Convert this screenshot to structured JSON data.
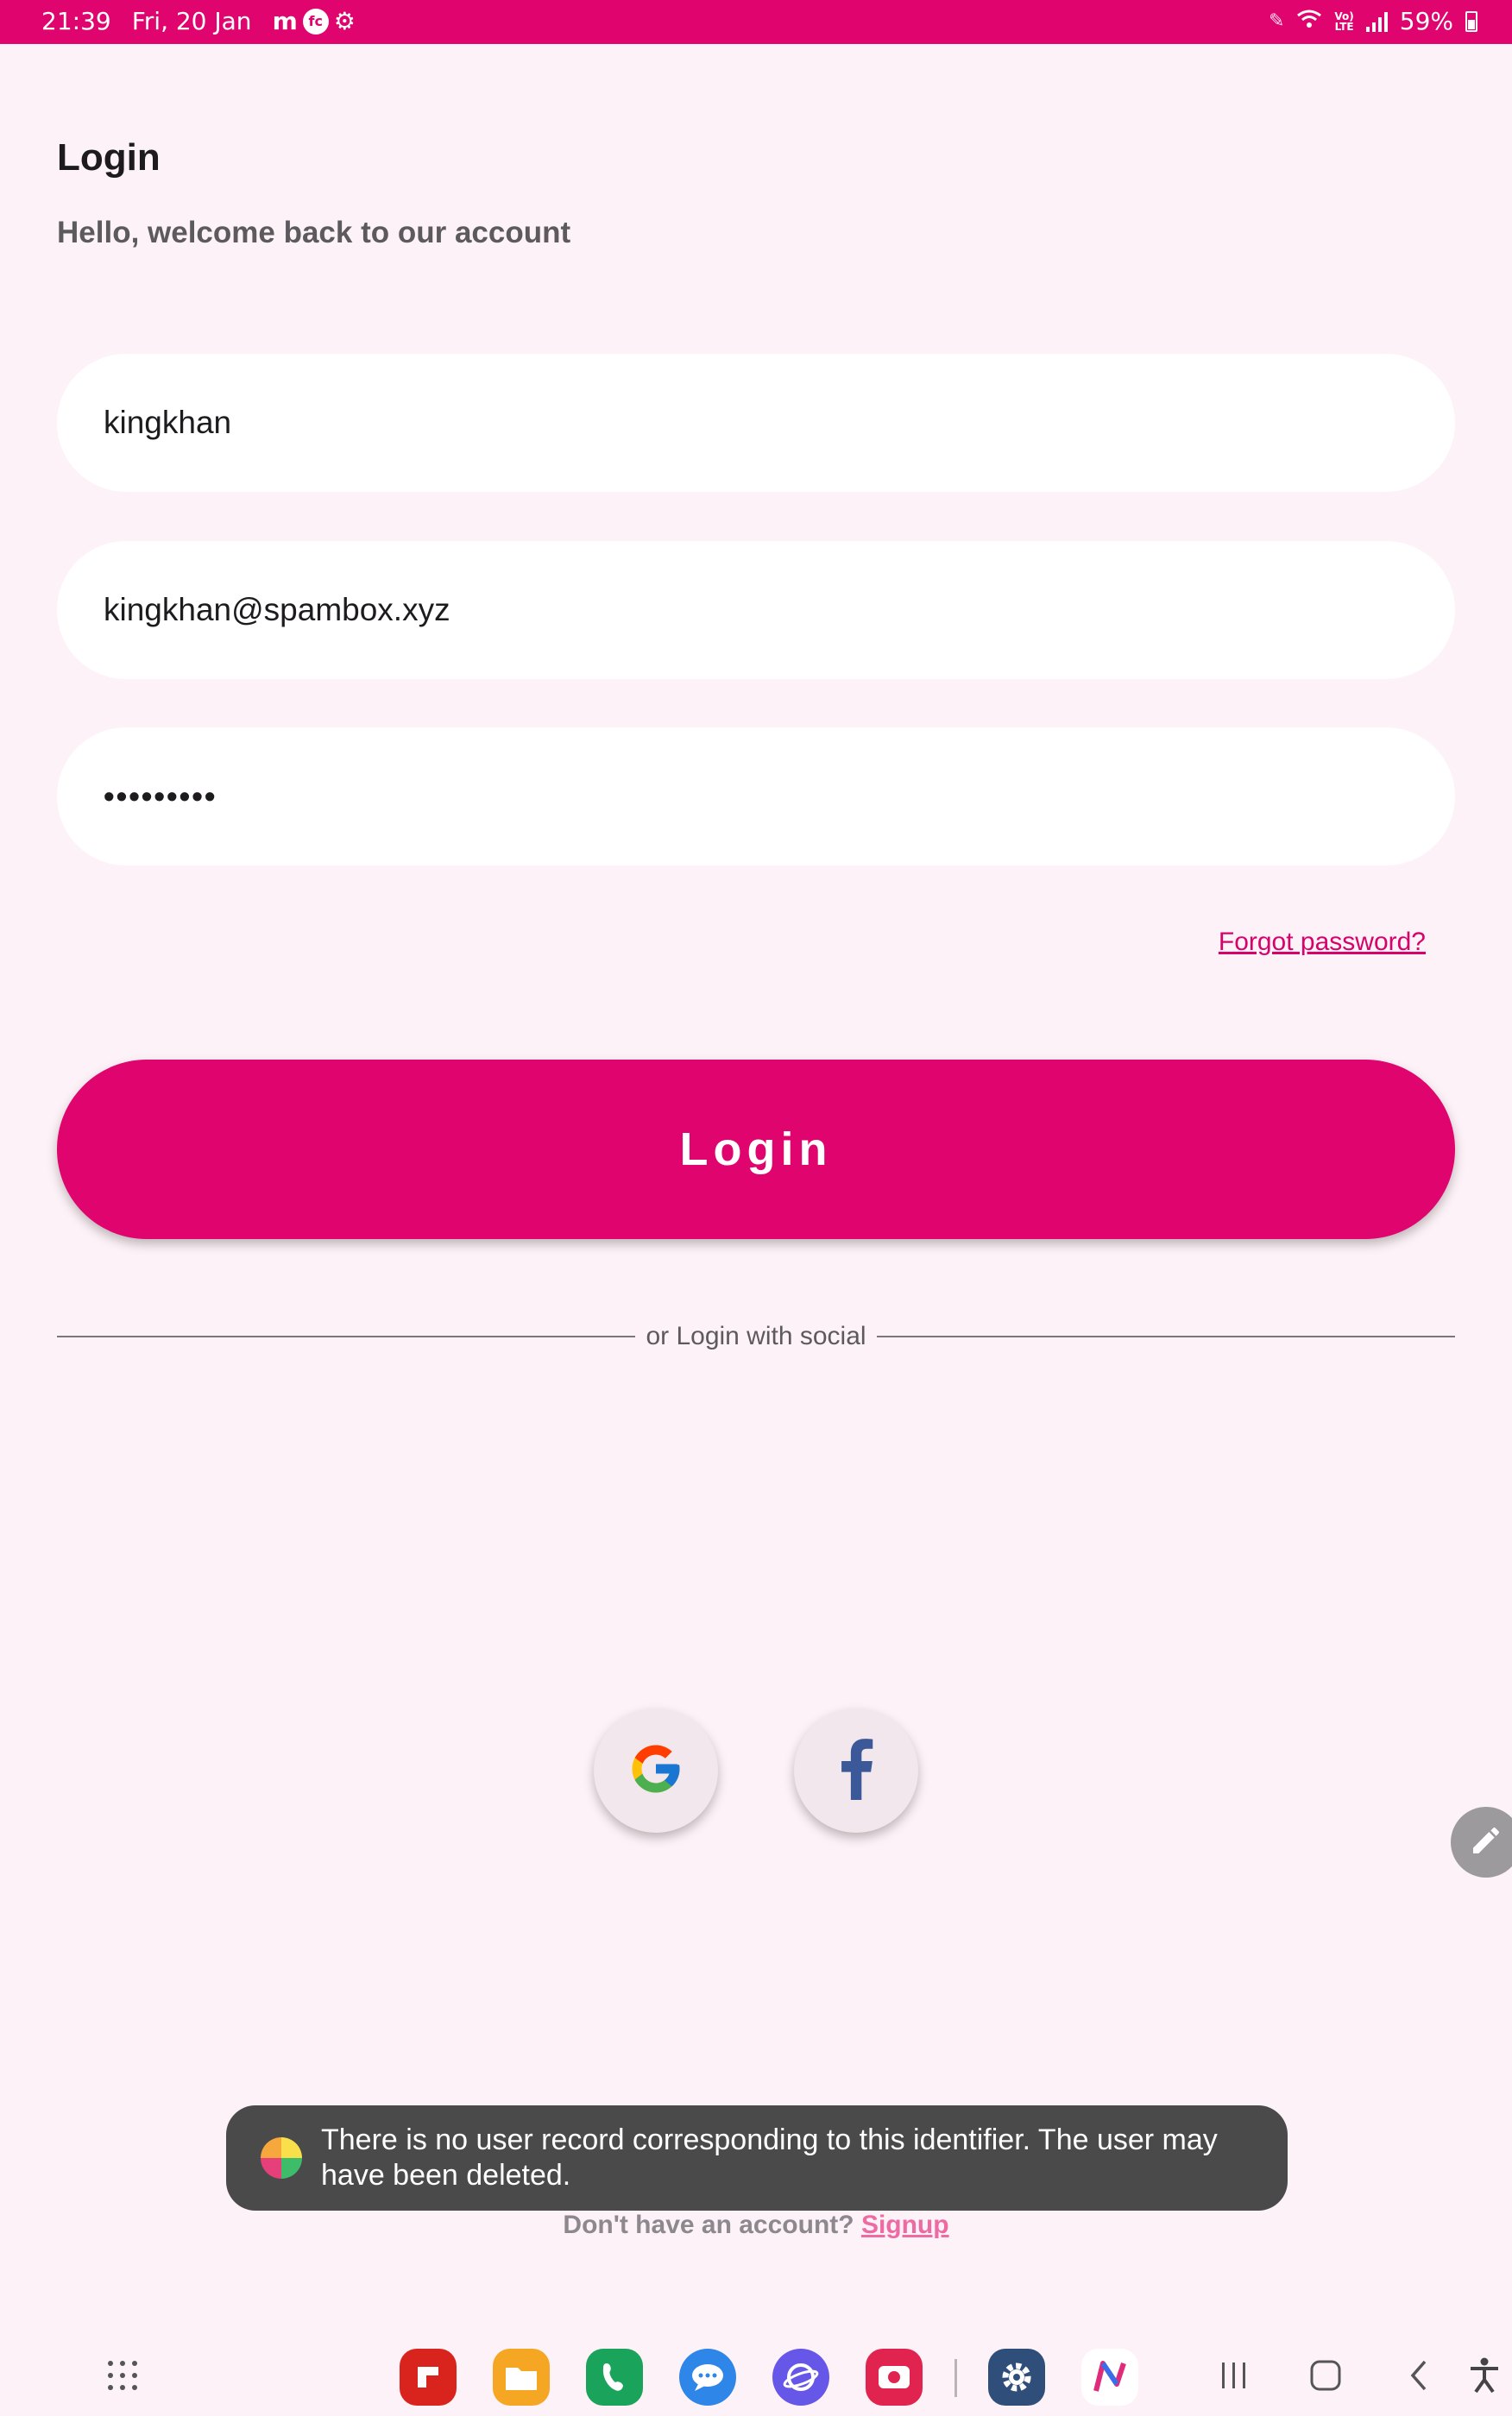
{
  "status_bar": {
    "time": "21:39",
    "date": "Fri, 20 Jan",
    "battery": "59%",
    "icons": [
      "messenger-icon",
      "app-notification-icon",
      "settings-gear-icon",
      "pen-icon",
      "wifi-icon",
      "volte-icon",
      "signal-icon",
      "battery-icon"
    ]
  },
  "header": {
    "title": "Login",
    "subtitle": "Hello, welcome back to our account"
  },
  "form": {
    "username_value": "kingkhan",
    "email_value": "kingkhan@spambox.xyz",
    "password_value": "•••••••••",
    "forgot_label": "Forgot password?",
    "login_label": "Login"
  },
  "social": {
    "divider_text": "or Login with social",
    "buttons": [
      "google-icon",
      "facebook-icon"
    ]
  },
  "toast": {
    "message": "There is no user record corresponding to this identifier. The user may have been deleted."
  },
  "footer": {
    "prompt": "Don't have an account?",
    "signup_label": "Signup"
  },
  "nav_bar": {
    "apps": [
      "all-apps-icon",
      "flipboard-icon",
      "my-files-icon",
      "phone-icon",
      "messages-icon",
      "samsung-internet-icon",
      "screen-recorder-icon",
      "settings-icon",
      "nova-icon"
    ],
    "keys": [
      "recents-icon",
      "home-icon",
      "back-icon",
      "accessibility-icon"
    ]
  },
  "colors": {
    "accent": "#e0046f",
    "background": "#fdf2f7",
    "link": "#d6046a",
    "toast": "#4a4a4a"
  }
}
